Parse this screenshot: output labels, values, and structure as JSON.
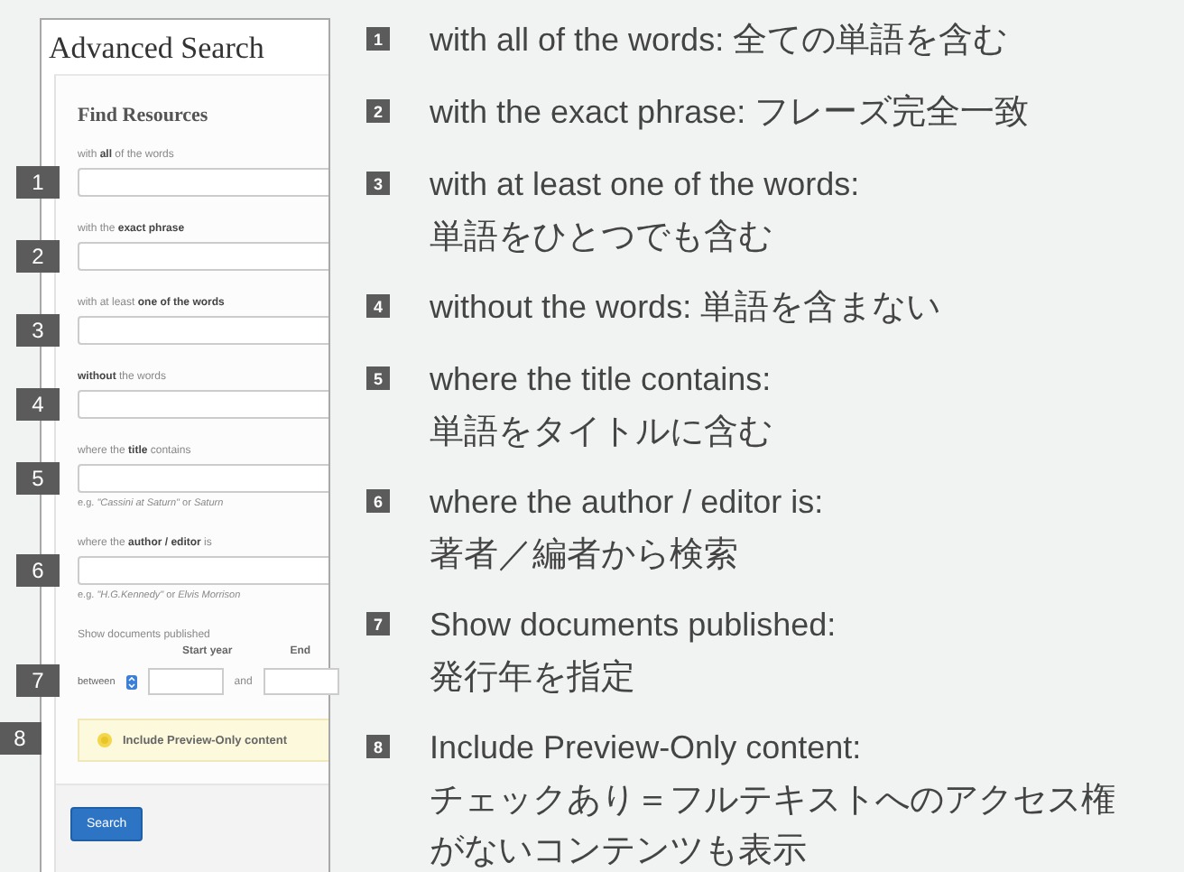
{
  "screenshot": {
    "title": "Advanced Search",
    "section": "Find Resources",
    "fields": [
      {
        "marker": "1",
        "label": "with **all** of the words"
      },
      {
        "marker": "2",
        "label": "with the **exact phrase**"
      },
      {
        "marker": "3",
        "label": "with at least **one of the words**"
      },
      {
        "marker": "4",
        "label": "**without** the words"
      },
      {
        "marker": "5",
        "label": "where the **title** contains",
        "hint": "e.g. *\"Cassini at Saturn\"* or *Saturn*"
      },
      {
        "marker": "6",
        "label": "where the **author / editor** is",
        "hint": "e.g. *\"H.G.Kennedy\"* or *Elvis Morrison*"
      }
    ],
    "date": {
      "label": "Show documents published",
      "start_label": "Start year",
      "end_label": "End",
      "marker": "7",
      "mode": "between",
      "joiner": "and"
    },
    "preview": {
      "marker": "8",
      "label": "Include Preview-Only content"
    },
    "search_button": "Search"
  },
  "legend": [
    {
      "number": "1",
      "kind": "same_line",
      "english": "with all of the words:",
      "japanese": "全ての単語を含む"
    },
    {
      "number": "2",
      "kind": "same_line",
      "english": "with the exact phrase:",
      "japanese": "フレーズ完全一致"
    },
    {
      "number": "3",
      "kind": "next_line",
      "english": "with at least one of the words:",
      "japanese": "単語をひとつでも含む"
    },
    {
      "number": "4",
      "kind": "same_line",
      "english": "without the words:",
      "japanese": "単語を含まない"
    },
    {
      "number": "5",
      "kind": "next_line",
      "english": "where the title contains:",
      "japanese": "単語をタイトルに含む"
    },
    {
      "number": "6",
      "kind": "next_line",
      "english": "where the author / editor is:",
      "japanese": "著者／編者から検索"
    },
    {
      "number": "7",
      "kind": "next_line",
      "english": "Show documents published:",
      "japanese": "発行年を指定"
    },
    {
      "number": "8",
      "kind": "next_line",
      "english": "Include Preview-Only content:",
      "japanese": "チェックあり＝フルテキストへのアクセス権がないコンテンツも表示"
    }
  ]
}
